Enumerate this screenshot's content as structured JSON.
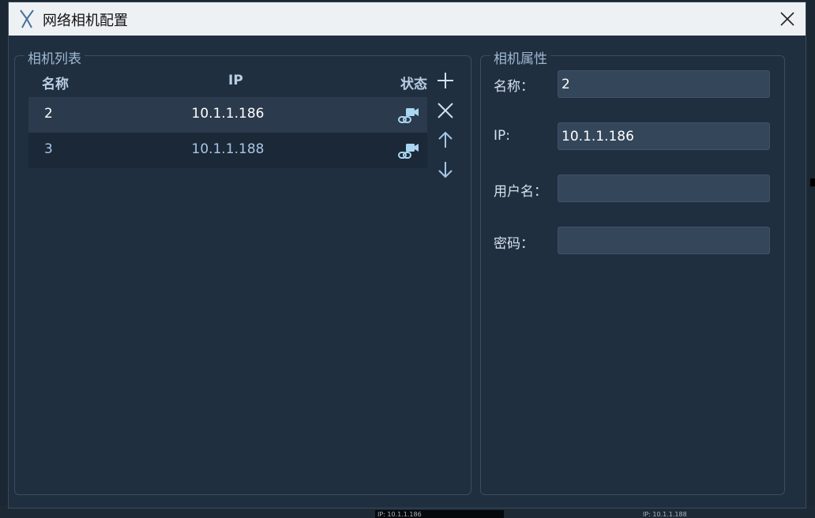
{
  "window": {
    "title": "网络相机配置"
  },
  "camera_list": {
    "group_title": "相机列表",
    "columns": {
      "name": "名称",
      "ip": "IP",
      "status": "状态"
    },
    "rows": [
      {
        "name": "2",
        "ip": "10.1.1.186",
        "status_icon": "camera-link-icon",
        "selected": true
      },
      {
        "name": "3",
        "ip": "10.1.1.188",
        "status_icon": "camera-link-icon",
        "selected": false
      }
    ]
  },
  "side_buttons": [
    "add-icon",
    "delete-icon",
    "arrow-up-icon",
    "arrow-down-icon"
  ],
  "properties": {
    "group_title": "相机属性",
    "name_label": "名称：",
    "name_value": "2",
    "ip_label": "IP:",
    "ip_value": "10.1.1.186",
    "username_label": "用户名：",
    "username_value": "",
    "password_label": "密码：",
    "password_value": ""
  },
  "background": {
    "ip_text_1": "IP: 10.1.1.186",
    "ip_text_2": "IP: 10.1.1.188"
  },
  "colors": {
    "accent": "#9fb7cf",
    "panel": "#1f2f40",
    "selected_row": "#2b3a4c",
    "status_icon": "#a9d6f0"
  }
}
